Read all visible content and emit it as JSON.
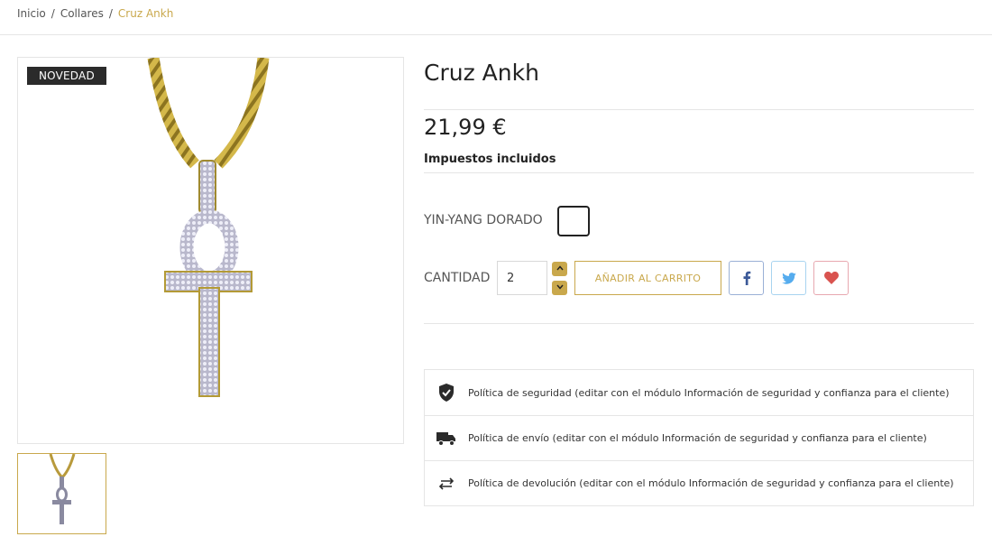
{
  "breadcrumb": {
    "items": [
      "Inicio",
      "Collares"
    ],
    "separator": "/",
    "current": "Cruz Ankh"
  },
  "product": {
    "badge": "NOVEDAD",
    "title": "Cruz Ankh",
    "price": "21,99 €",
    "tax_note": "Impuestos incluidos",
    "variant_label": "YIN-YANG DORADO",
    "quantity_label": "CANTIDAD",
    "quantity_value": "2",
    "add_to_cart": "AÑADIR AL CARRITO"
  },
  "social": {
    "facebook": "facebook-icon",
    "twitter": "twitter-icon",
    "wishlist": "heart-icon"
  },
  "reassurance": [
    {
      "icon": "shield-check-icon",
      "text": "Política de seguridad (editar con el módulo Información de seguridad y confianza para el cliente)"
    },
    {
      "icon": "truck-icon",
      "text": "Política de envío (editar con el módulo Información de seguridad y confianza para el cliente)"
    },
    {
      "icon": "arrows-swap-icon",
      "text": "Política de devolución (editar con el módulo Información de seguridad y confianza para el cliente)"
    }
  ],
  "colors": {
    "accent": "#c9a84c",
    "badge_bg": "#2b2b2b",
    "facebook": "#3b5998",
    "twitter": "#55acee",
    "wishlist": "#d9534f"
  }
}
